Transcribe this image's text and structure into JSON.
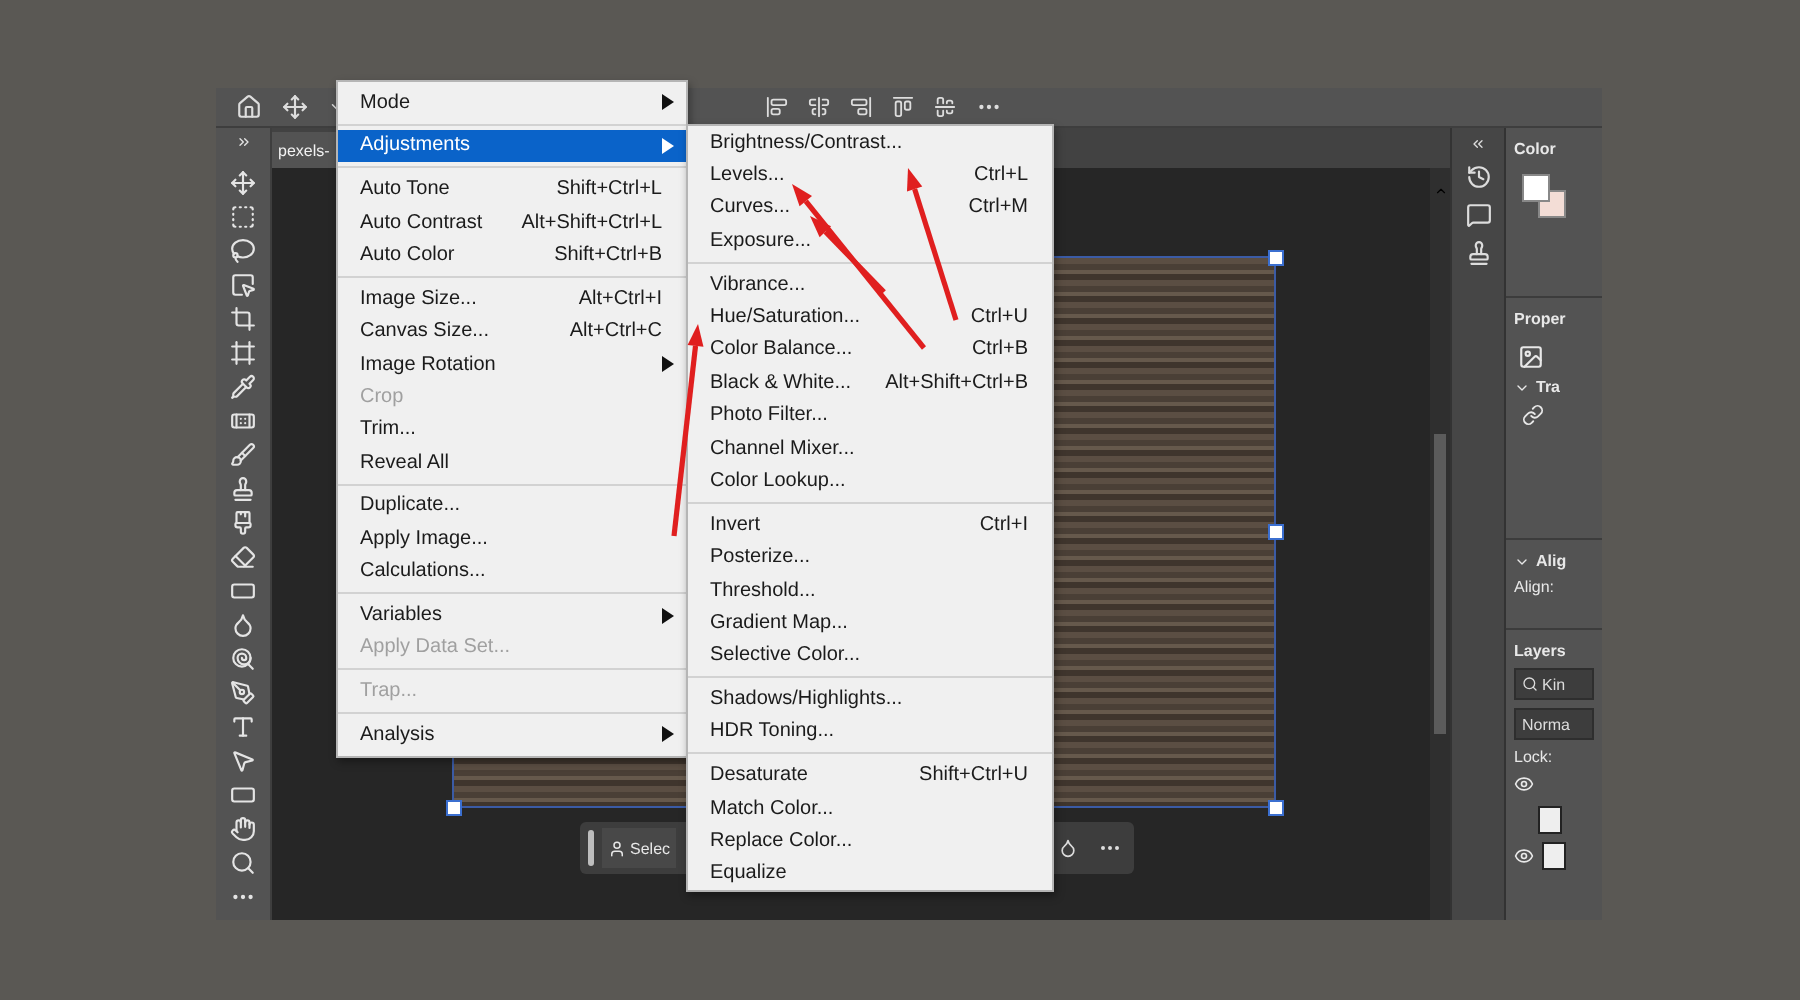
{
  "document_tab": {
    "title": "pexels-"
  },
  "image_menu": {
    "items": [
      {
        "kind": "item",
        "label": "Mode",
        "submenu": true,
        "selected": false,
        "disabled": false
      },
      {
        "kind": "separator"
      },
      {
        "kind": "item",
        "label": "Adjustments",
        "submenu": true,
        "selected": true,
        "disabled": false
      },
      {
        "kind": "separator"
      },
      {
        "kind": "item",
        "label": "Auto Tone",
        "shortcut": "Shift+Ctrl+L",
        "submenu": false,
        "selected": false,
        "disabled": false
      },
      {
        "kind": "item",
        "label": "Auto Contrast",
        "shortcut": "Alt+Shift+Ctrl+L",
        "submenu": false,
        "selected": false,
        "disabled": false
      },
      {
        "kind": "item",
        "label": "Auto Color",
        "shortcut": "Shift+Ctrl+B",
        "submenu": false,
        "selected": false,
        "disabled": false
      },
      {
        "kind": "separator"
      },
      {
        "kind": "item",
        "label": "Image Size...",
        "shortcut": "Alt+Ctrl+I",
        "submenu": false,
        "selected": false,
        "disabled": false
      },
      {
        "kind": "item",
        "label": "Canvas Size...",
        "shortcut": "Alt+Ctrl+C",
        "submenu": false,
        "selected": false,
        "disabled": false
      },
      {
        "kind": "item",
        "label": "Image Rotation",
        "submenu": true,
        "selected": false,
        "disabled": false
      },
      {
        "kind": "item",
        "label": "Crop",
        "submenu": false,
        "selected": false,
        "disabled": true
      },
      {
        "kind": "item",
        "label": "Trim...",
        "submenu": false,
        "selected": false,
        "disabled": false
      },
      {
        "kind": "item",
        "label": "Reveal All",
        "submenu": false,
        "selected": false,
        "disabled": false
      },
      {
        "kind": "separator"
      },
      {
        "kind": "item",
        "label": "Duplicate...",
        "submenu": false,
        "selected": false,
        "disabled": false
      },
      {
        "kind": "item",
        "label": "Apply Image...",
        "submenu": false,
        "selected": false,
        "disabled": false
      },
      {
        "kind": "item",
        "label": "Calculations...",
        "submenu": false,
        "selected": false,
        "disabled": false
      },
      {
        "kind": "separator"
      },
      {
        "kind": "item",
        "label": "Variables",
        "submenu": true,
        "selected": false,
        "disabled": false
      },
      {
        "kind": "item",
        "label": "Apply Data Set...",
        "submenu": false,
        "selected": false,
        "disabled": true
      },
      {
        "kind": "separator"
      },
      {
        "kind": "item",
        "label": "Trap...",
        "submenu": false,
        "selected": false,
        "disabled": true
      },
      {
        "kind": "separator"
      },
      {
        "kind": "item",
        "label": "Analysis",
        "submenu": true,
        "selected": false,
        "disabled": false
      }
    ]
  },
  "adjustments_submenu": {
    "items": [
      {
        "kind": "item",
        "label": "Brightness/Contrast..."
      },
      {
        "kind": "item",
        "label": "Levels...",
        "shortcut": "Ctrl+L"
      },
      {
        "kind": "item",
        "label": "Curves...",
        "shortcut": "Ctrl+M"
      },
      {
        "kind": "item",
        "label": "Exposure..."
      },
      {
        "kind": "separator"
      },
      {
        "kind": "item",
        "label": "Vibrance..."
      },
      {
        "kind": "item",
        "label": "Hue/Saturation...",
        "shortcut": "Ctrl+U"
      },
      {
        "kind": "item",
        "label": "Color Balance...",
        "shortcut": "Ctrl+B"
      },
      {
        "kind": "item",
        "label": "Black & White...",
        "shortcut": "Alt+Shift+Ctrl+B"
      },
      {
        "kind": "item",
        "label": "Photo Filter..."
      },
      {
        "kind": "item",
        "label": "Channel Mixer..."
      },
      {
        "kind": "item",
        "label": "Color Lookup..."
      },
      {
        "kind": "separator"
      },
      {
        "kind": "item",
        "label": "Invert",
        "shortcut": "Ctrl+I"
      },
      {
        "kind": "item",
        "label": "Posterize..."
      },
      {
        "kind": "item",
        "label": "Threshold..."
      },
      {
        "kind": "item",
        "label": "Gradient Map..."
      },
      {
        "kind": "item",
        "label": "Selective Color..."
      },
      {
        "kind": "separator"
      },
      {
        "kind": "item",
        "label": "Shadows/Highlights..."
      },
      {
        "kind": "item",
        "label": "HDR Toning..."
      },
      {
        "kind": "separator"
      },
      {
        "kind": "item",
        "label": "Desaturate",
        "shortcut": "Shift+Ctrl+U"
      },
      {
        "kind": "item",
        "label": "Match Color..."
      },
      {
        "kind": "item",
        "label": "Replace Color..."
      },
      {
        "kind": "item",
        "label": "Equalize"
      }
    ]
  },
  "context_bar": {
    "select_button": "Selec"
  },
  "color_panel": {
    "title": "Color"
  },
  "properties_panel": {
    "title": "Proper",
    "section": "Tra"
  },
  "align_panel": {
    "title": "Alig",
    "label": "Align:"
  },
  "layers_panel": {
    "title": "Layers",
    "search": {
      "placeholder": "Kin"
    },
    "blend_mode": "Norma",
    "lock_label": "Lock:"
  }
}
